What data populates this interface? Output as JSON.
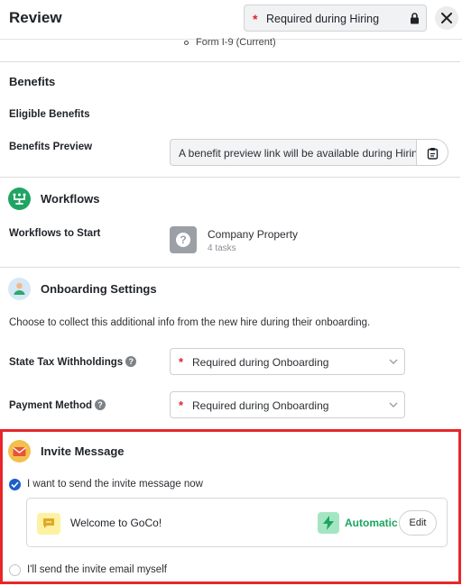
{
  "header": {
    "title": "Review",
    "requirement_pill": {
      "star": "*",
      "label": "Required during Hiring",
      "icon": "lock-icon"
    },
    "close_icon": "close-icon"
  },
  "forms_list": {
    "last_item": "Form I-9 (Current)"
  },
  "benefits": {
    "title": "Benefits",
    "eligible_label": "Eligible Benefits",
    "preview_label": "Benefits Preview",
    "preview_value": "A benefit preview link will be available during Hiring",
    "copy_icon": "clipboard-icon"
  },
  "workflows": {
    "title": "Workflows",
    "icon": "workflow-icon",
    "start_label": "Workflows to Start",
    "item": {
      "name": "Company Property",
      "tasks": "4 tasks",
      "icon": "question-icon"
    }
  },
  "onboarding": {
    "title": "Onboarding Settings",
    "icon": "person-icon",
    "description": "Choose to collect this additional info from the new hire during their onboarding.",
    "state_tax": {
      "label": "State Tax Withholdings",
      "help": "?",
      "star": "*",
      "value": "Required during Onboarding"
    },
    "payment": {
      "label": "Payment Method",
      "help": "?",
      "star": "*",
      "value": "Required during Onboarding"
    }
  },
  "invite": {
    "title": "Invite Message",
    "icon": "envelope-icon",
    "option_send_now": {
      "label": "I want to send the invite message now",
      "checked": true
    },
    "message": {
      "title": "Welcome to GoCo!",
      "trigger": "Automatic",
      "edit_label": "Edit"
    },
    "option_self": {
      "label": "I'll send the invite email myself",
      "checked": false
    }
  },
  "colors": {
    "required_star": "#e0242b",
    "highlight_box": "#e8262a",
    "automatic": "#1aa660",
    "checkbox": "#1b5fc9"
  }
}
